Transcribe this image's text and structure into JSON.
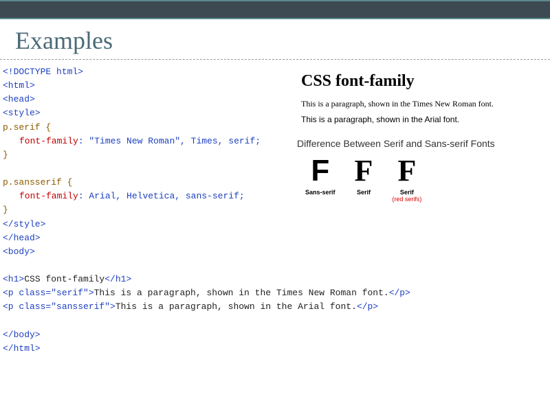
{
  "slide": {
    "title": "Examples"
  },
  "code": {
    "lines": [
      {
        "type": "tag",
        "text": "<!DOCTYPE html>"
      },
      {
        "type": "tag",
        "text": "<html>"
      },
      {
        "type": "tag",
        "text": "<head>"
      },
      {
        "type": "tag",
        "text": "<style>"
      },
      {
        "type": "sel",
        "text": "p.serif {"
      },
      {
        "type": "prop",
        "prop": "font-family",
        "val": ": \"Times New Roman\", Times, serif;"
      },
      {
        "type": "sel",
        "text": "}"
      },
      {
        "type": "blank",
        "text": ""
      },
      {
        "type": "sel",
        "text": "p.sansserif {"
      },
      {
        "type": "prop",
        "prop": "font-family",
        "val": ": Arial, Helvetica, sans-serif;"
      },
      {
        "type": "sel",
        "text": "}"
      },
      {
        "type": "tag",
        "text": "</style>"
      },
      {
        "type": "tag",
        "text": "</head>"
      },
      {
        "type": "tag",
        "text": "<body>"
      },
      {
        "type": "blank",
        "text": ""
      },
      {
        "type": "mix",
        "open": "<h1>",
        "body": "CSS font-family",
        "close": "</h1>"
      },
      {
        "type": "mix",
        "open": "<p class=\"serif\">",
        "body": "This is a paragraph, shown in the Times New Roman font.",
        "close": "</p>"
      },
      {
        "type": "mix",
        "open": "<p class=\"sansserif\">",
        "body": "This is a paragraph, shown in the Arial font.",
        "close": "</p>"
      },
      {
        "type": "blank",
        "text": ""
      },
      {
        "type": "tag",
        "text": "</body>"
      },
      {
        "type": "tag",
        "text": "</html>"
      }
    ]
  },
  "preview": {
    "heading": "CSS font-family",
    "serif": "This is a paragraph, shown in the Times New Roman font.",
    "sans": "This is a paragraph, shown in the Arial font."
  },
  "diagram": {
    "title": "Difference Between Serif and Sans-serif Fonts",
    "cols": [
      {
        "glyph": "F",
        "style": "sans",
        "label": "Sans-serif",
        "sublabel": ""
      },
      {
        "glyph": "F",
        "style": "serif",
        "label": "Serif",
        "sublabel": ""
      },
      {
        "glyph": "F",
        "style": "serif-red",
        "label": "Serif",
        "sublabel": "(red serifs)"
      }
    ]
  }
}
